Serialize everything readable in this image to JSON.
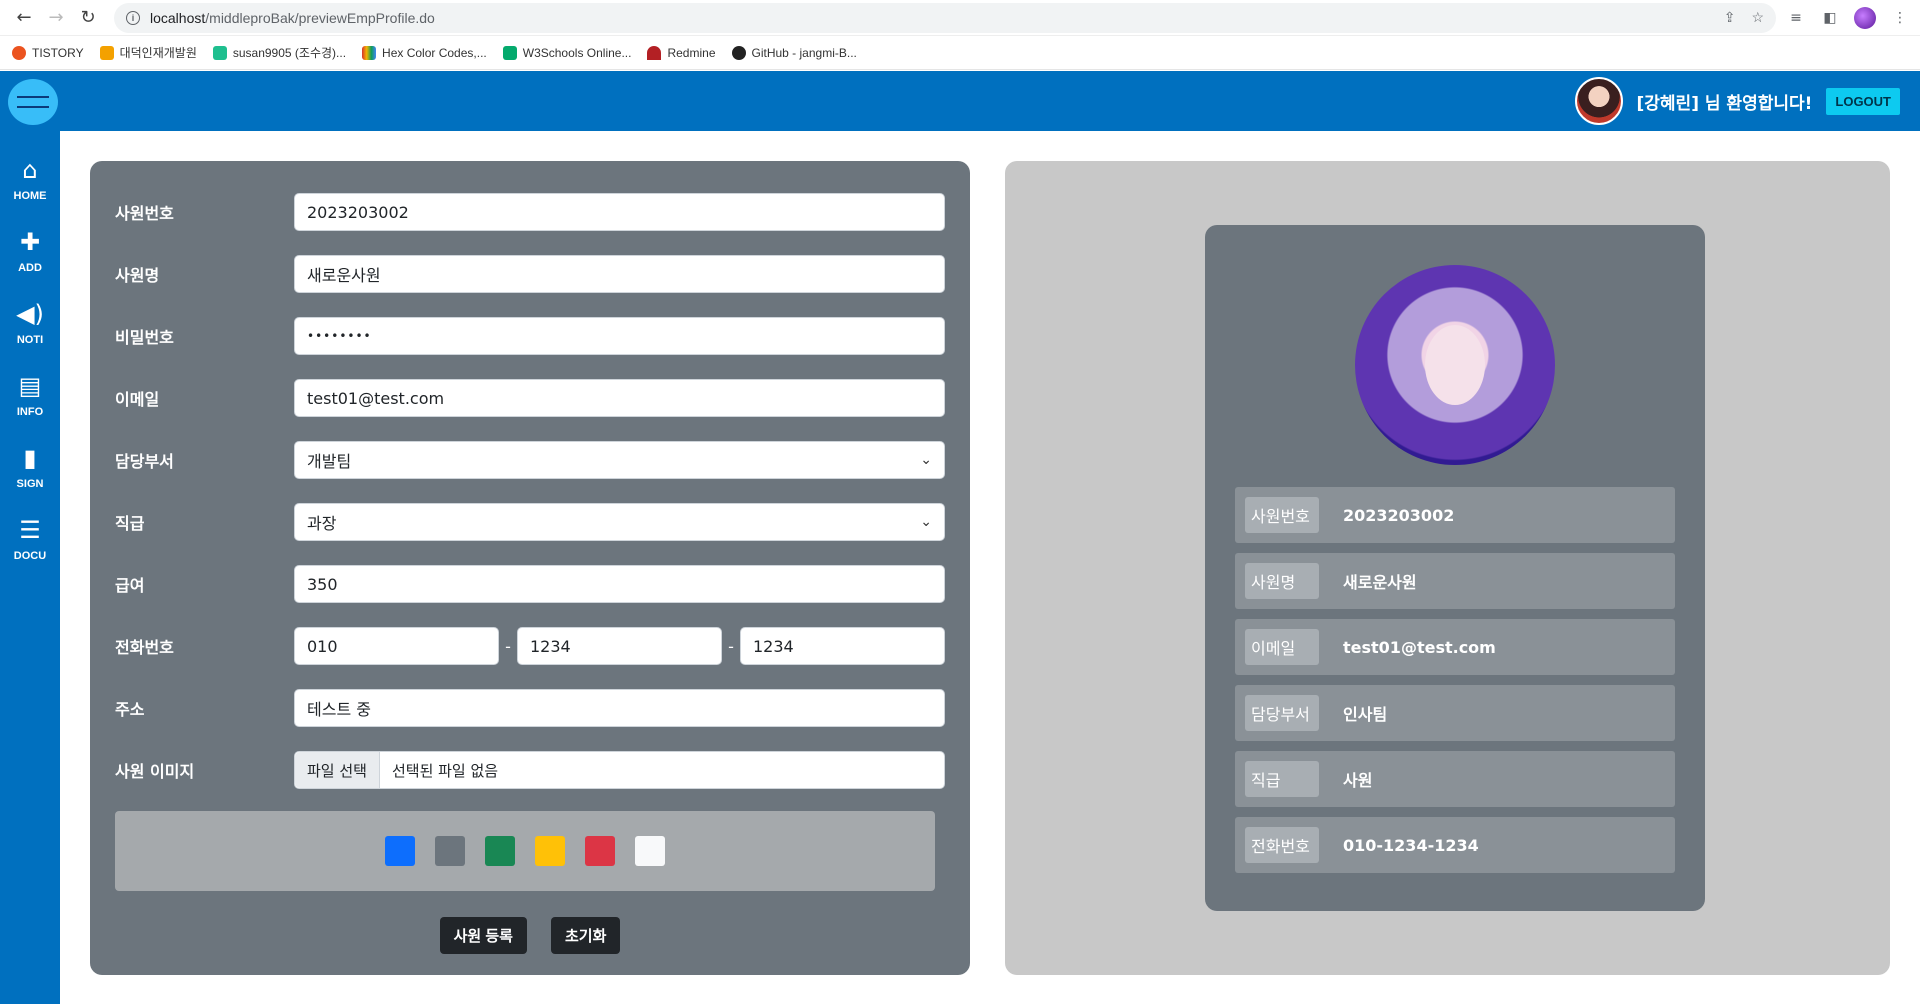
{
  "browser": {
    "url_host": "localhost",
    "url_path": "/middleproBak/previewEmpProfile.do",
    "bookmarks": [
      {
        "label": "TISTORY",
        "color": "#eb531f"
      },
      {
        "label": "대덕인재개발원",
        "color": "#f4a100"
      },
      {
        "label": "susan9905 (조수경)...",
        "color": "#1fbf8f"
      },
      {
        "label": "Hex Color Codes,...",
        "color": "#d6332f"
      },
      {
        "label": "W3Schools Online...",
        "color": "#04aa6d"
      },
      {
        "label": "Redmine",
        "color": "#b32024"
      },
      {
        "label": "GitHub - jangmi-B...",
        "color": "#222222"
      }
    ]
  },
  "header": {
    "welcome": "[강혜린] 님 환영합니다!",
    "logout_label": "LOGOUT"
  },
  "sidebar": {
    "items": [
      {
        "label": "HOME",
        "icon": "home-icon",
        "glyph": "⌂"
      },
      {
        "label": "ADD",
        "icon": "add-user-icon",
        "glyph": "✚"
      },
      {
        "label": "NOTI",
        "icon": "speaker-icon",
        "glyph": "🔊"
      },
      {
        "label": "INFO",
        "icon": "id-card-icon",
        "glyph": "▤"
      },
      {
        "label": "SIGN",
        "icon": "clipboard-icon",
        "glyph": "📋"
      },
      {
        "label": "DOCU",
        "icon": "list-icon",
        "glyph": "☰"
      }
    ]
  },
  "form": {
    "emp_no_label": "사원번호",
    "emp_no": "2023203002",
    "emp_name_label": "사원명",
    "emp_name": "새로운사원",
    "password_label": "비밀번호",
    "password_mask": "••••••••",
    "email_label": "이메일",
    "email": "test01@test.com",
    "dept_label": "담당부서",
    "dept": "개발팀",
    "rank_label": "직급",
    "rank": "과장",
    "salary_label": "급여",
    "salary": "350",
    "tel_label": "전화번호",
    "tel1": "010",
    "tel2": "1234",
    "tel3": "1234",
    "tel_sep": "-",
    "address_label": "주소",
    "address": "테스트 중",
    "image_label": "사원 이미지",
    "file_button": "파일 선택",
    "file_text": "선택된 파일 없음",
    "colors": [
      "#0d6efd",
      "#6c757d",
      "#198754",
      "#ffc107",
      "#dc3545",
      "#f8f9fa"
    ],
    "submit_label": "사원 등록",
    "reset_label": "초기화"
  },
  "preview": {
    "rows": [
      {
        "label": "사원번호",
        "value": "2023203002"
      },
      {
        "label": "사원명",
        "value": "새로운사원"
      },
      {
        "label": "이메일",
        "value": "test01@test.com"
      },
      {
        "label": "담당부서",
        "value": "인사팀"
      },
      {
        "label": "직급",
        "value": "사원"
      },
      {
        "label": "전화번호",
        "value": "010-1234-1234"
      }
    ]
  }
}
